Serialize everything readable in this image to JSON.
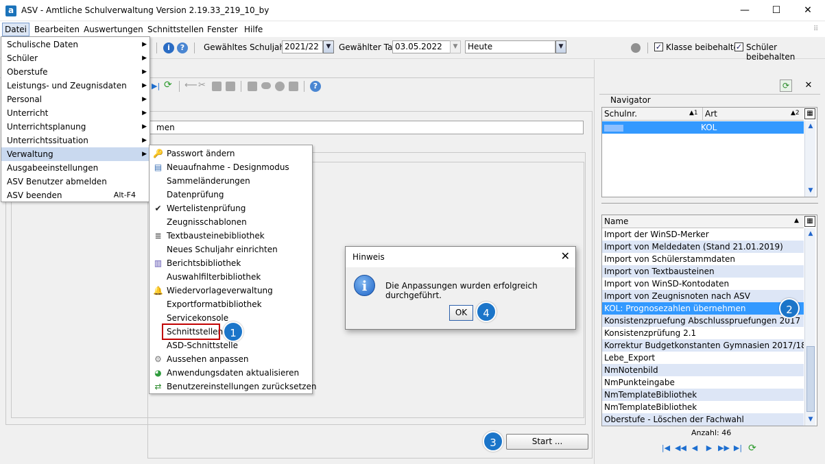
{
  "window": {
    "title": "ASV - Amtliche Schulverwaltung Version 2.19.33_219_10_by",
    "app_icon": "a",
    "controls": [
      "—",
      "☐",
      "✕"
    ]
  },
  "menubar": {
    "items": [
      "Datei",
      "Bearbeiten",
      "Auswertungen",
      "Schnittstellen",
      "Fenster",
      "Hilfe"
    ]
  },
  "toolbar": {
    "schuljahr_label": "Gewähltes Schuljahr",
    "schuljahr_value": "2021/22",
    "tag_label": "Gewählter Tag",
    "tag_value": "03.05.2022",
    "heute_value": "Heute",
    "klasse_label": "Klasse beibehalten",
    "klasse_checked": true,
    "schueler_label": "Schüler beibehalten",
    "schueler_checked": true
  },
  "main": {
    "field_text": "men",
    "start_button": "Start ..."
  },
  "datei_menu": {
    "items": [
      {
        "label": "Schulische Daten",
        "submenu": true
      },
      {
        "label": "Schüler",
        "submenu": true
      },
      {
        "label": "Oberstufe",
        "submenu": true
      },
      {
        "label": "Leistungs- und Zeugnisdaten",
        "submenu": true
      },
      {
        "label": "Personal",
        "submenu": true
      },
      {
        "label": "Unterricht",
        "submenu": true
      },
      {
        "label": "Unterrichtsplanung",
        "submenu": true
      },
      {
        "label": "Unterrichtssituation",
        "submenu": true
      },
      {
        "label": "Verwaltung",
        "submenu": true,
        "highlighted": true
      },
      {
        "label": "Ausgabeeinstellungen",
        "submenu": false
      },
      {
        "label": "ASV Benutzer abmelden",
        "submenu": false
      },
      {
        "label": "ASV beenden",
        "submenu": false,
        "shortcut": "Alt-F4"
      }
    ]
  },
  "verwaltung_menu": {
    "items": [
      {
        "label": "Passwort ändern",
        "icon": "key-icon"
      },
      {
        "label": "Neuaufnahme - Designmodus",
        "icon": "form-icon"
      },
      {
        "label": "Sammeländerungen",
        "icon": ""
      },
      {
        "label": "Datenprüfung",
        "icon": ""
      },
      {
        "label": "Wertelistenprüfung",
        "icon": "check-icon"
      },
      {
        "label": "Zeugnisschablonen",
        "icon": ""
      },
      {
        "label": "Textbausteinebibliothek",
        "icon": "text-icon"
      },
      {
        "label": "Neues Schuljahr einrichten",
        "icon": ""
      },
      {
        "label": "Berichtsbibliothek",
        "icon": "book-icon"
      },
      {
        "label": "Auswahlfilterbibliothek",
        "icon": ""
      },
      {
        "label": "Wiedervorlageverwaltung",
        "icon": "bell-icon"
      },
      {
        "label": "Exportformatbibliothek",
        "icon": ""
      },
      {
        "label": "Servicekonsole",
        "icon": ""
      },
      {
        "label": "Schnittstellen",
        "icon": ""
      },
      {
        "label": "ASD-Schnittstelle",
        "icon": ""
      },
      {
        "label": "Aussehen anpassen",
        "icon": "gear-icon"
      },
      {
        "label": "Anwendungsdaten aktualisieren",
        "icon": "globe-icon"
      },
      {
        "label": "Benutzereinstellungen zurücksetzen",
        "icon": "reset-icon"
      }
    ]
  },
  "navigator": {
    "title": "Navigator",
    "col_schulnr": "Schulnr.",
    "col_schulnr_sort": "▲1",
    "col_art": "Art",
    "col_art_sort": "▲2",
    "row_art": "KOL",
    "name_header": "Name",
    "items": [
      "Import der WinSD-Merker",
      "Import von Meldedaten (Stand 21.01.2019)",
      "Import von Schülerstammdaten",
      "Import von Textbausteinen",
      "Import von WinSD-Kontodaten",
      "Import von Zeugnisnoten nach ASV",
      "KOL: Prognosezahlen übernehmen",
      "Konsistenzpruefung Abschlusspruefungen 2017",
      "Konsistenzprüfung 2.1",
      "Korrektur Budgetkonstanten Gymnasien 2017/18",
      "Lebe_Export",
      "NmNotenbild",
      "NmPunkteingabe",
      "NmTemplateBibliothek",
      "NmTemplateBibliothek",
      "Oberstufe - Löschen der Fachwahl"
    ],
    "selected_index": 6,
    "count_text": "Anzahl: 46"
  },
  "dialog": {
    "title": "Hinweis",
    "message": "Die Anpassungen wurden erfolgreich durchgeführt.",
    "ok": "OK"
  },
  "markers": [
    "1",
    "2",
    "3",
    "4"
  ],
  "colors": {
    "selection": "#3399ff",
    "row_alt": "#dde6f6",
    "marker": "#1b75c9",
    "highlight_box": "#c00000"
  }
}
